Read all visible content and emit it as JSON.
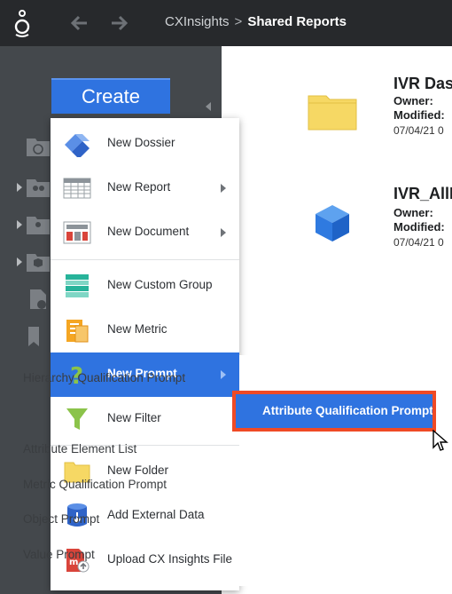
{
  "header": {
    "breadcrumb_root": "CXInsights",
    "breadcrumb_separator": ">",
    "breadcrumb_current": "Shared Reports"
  },
  "sidebar": {
    "create_label": "Create"
  },
  "content": {
    "items": [
      {
        "title": "IVR Das",
        "owner_label": "Owner:",
        "modified_label": "Modified:",
        "date": "07/04/21 0",
        "icon": "folder-icon"
      },
      {
        "title": "IVR_AllE",
        "owner_label": "Owner:",
        "modified_label": "Modified:",
        "date": "07/04/21 0",
        "icon": "cube-icon"
      }
    ]
  },
  "create_menu": {
    "items": [
      {
        "label": "New Dossier",
        "icon": "dossier-icon"
      },
      {
        "label": "New Report",
        "icon": "report-grid-icon",
        "has_submenu": true
      },
      {
        "label": "New Document",
        "icon": "document-icon",
        "has_submenu": true
      },
      {
        "label": "New Custom Group",
        "icon": "custom-group-icon"
      },
      {
        "label": "New Metric",
        "icon": "metric-icon"
      },
      {
        "label": "New Prompt",
        "icon": "prompt-question-icon",
        "has_submenu": true,
        "active": true
      },
      {
        "label": "New Filter",
        "icon": "filter-funnel-icon"
      },
      {
        "label": "New Folder",
        "icon": "folder-icon"
      },
      {
        "label": "Add External Data",
        "icon": "external-data-icon"
      },
      {
        "label": "Upload CX Insights File",
        "icon": "upload-file-icon"
      }
    ]
  },
  "prompt_submenu": {
    "items": [
      "Hierarchy Qualification Prompt",
      "Attribute Qualification Prompt",
      "Attribute Element List",
      "Metric Qualification Prompt",
      "Object Prompt",
      "Value Prompt"
    ],
    "highlighted": "Attribute Qualification Prompt"
  },
  "colors": {
    "accent": "#2f73e0",
    "highlight": "#ef4a25",
    "topbar": "#27292c",
    "sidebar": "#44484c"
  }
}
